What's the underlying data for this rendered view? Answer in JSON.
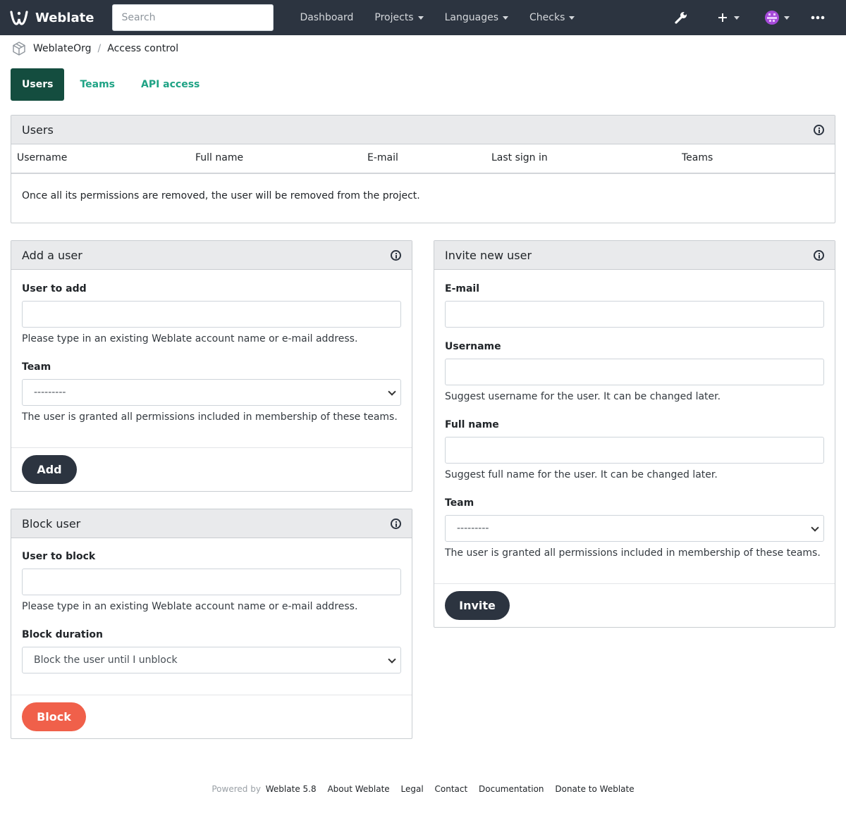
{
  "navbar": {
    "brand": "Weblate",
    "search_placeholder": "Search",
    "links": [
      "Dashboard",
      "Projects",
      "Languages",
      "Checks"
    ],
    "icons": [
      "wrench-icon",
      "plus-icon",
      "avatar",
      "more-icon"
    ]
  },
  "breadcrumb": {
    "project": "WeblateOrg",
    "page": "Access control"
  },
  "tabs": [
    {
      "label": "Users",
      "active": true
    },
    {
      "label": "Teams",
      "active": false
    },
    {
      "label": "API access",
      "active": false
    }
  ],
  "users_panel": {
    "title": "Users",
    "columns": [
      "Username",
      "Full name",
      "E-mail",
      "Last sign in",
      "Teams"
    ],
    "note": "Once all its permissions are removed, the user will be removed from the project."
  },
  "add_user": {
    "title": "Add a user",
    "user_label": "User to add",
    "user_value": "",
    "user_help": "Please type in an existing Weblate account name or e-mail address.",
    "team_label": "Team",
    "team_value": "---------",
    "team_help": "The user is granted all permissions included in membership of these teams.",
    "button": "Add"
  },
  "block_user": {
    "title": "Block user",
    "user_label": "User to block",
    "user_value": "",
    "user_help": "Please type in an existing Weblate account name or e-mail address.",
    "duration_label": "Block duration",
    "duration_value": "Block the user until I unblock",
    "button": "Block"
  },
  "invite_user": {
    "title": "Invite new user",
    "email_label": "E-mail",
    "username_label": "Username",
    "username_help": "Suggest username for the user. It can be changed later.",
    "fullname_label": "Full name",
    "fullname_help": "Suggest full name for the user. It can be changed later.",
    "team_label": "Team",
    "team_value": "---------",
    "team_help": "The user is granted all permissions included in membership of these teams.",
    "button": "Invite"
  },
  "footer": {
    "powered_by": "Powered by",
    "links": [
      "Weblate 5.8",
      "About Weblate",
      "Legal",
      "Contact",
      "Documentation",
      "Donate to Weblate"
    ]
  },
  "colors": {
    "navbar": "#2c3440",
    "accent": "#1fa385",
    "active_tab": "#144d3f",
    "danger": "#f0604a"
  }
}
